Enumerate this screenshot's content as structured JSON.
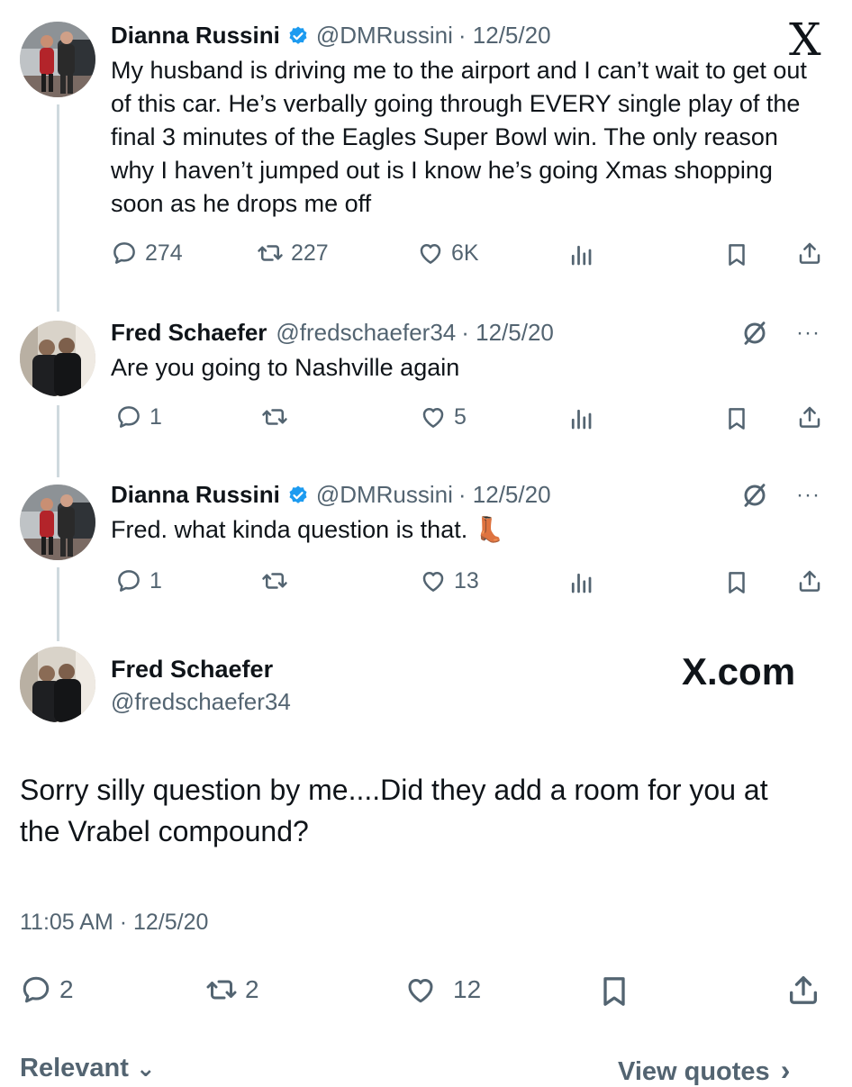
{
  "brand": {
    "x_logo": "X",
    "x_com": "X.com"
  },
  "tweets": [
    {
      "name": "Dianna Russini",
      "handle": "@DMRussini",
      "date": "· 12/5/20",
      "text": "My husband is driving me to the airport and I can’t wait to get out of this car. He’s verbally going through EVERY single play of the final 3 minutes of the Eagles Super Bowl win. The only reason why I haven’t jumped out is I know he’s going Xmas shopping soon as he drops me off",
      "replies": "274",
      "reposts": "227",
      "likes": "6K"
    },
    {
      "name": "Fred Schaefer",
      "handle": "@fredschaefer34",
      "date": "· 12/5/20",
      "text": "Are you going to Nashville again",
      "replies": "1",
      "reposts": "",
      "likes": "5",
      "more": "···"
    },
    {
      "name": "Dianna Russini",
      "handle": "@DMRussini",
      "date": "· 12/5/20",
      "text": "Fred. what kinda question is that. 👢",
      "replies": "1",
      "reposts": "",
      "likes": "13",
      "more": "···"
    }
  ],
  "main_tweet": {
    "name": "Fred Schaefer",
    "handle": "@fredschaefer34",
    "text": "Sorry silly question by me....Did they add a room for you at the Vrabel compound?",
    "timestamp": "11:05 AM · 12/5/20",
    "replies": "2",
    "reposts": "2",
    "likes": "12"
  },
  "footer": {
    "relevant": "Relevant",
    "relevant_chevron": "⌄",
    "view_quotes": "View quotes",
    "view_quotes_chevron": "›"
  },
  "colors": {
    "text": "#0f1419",
    "muted": "#536471",
    "verified": "#1d9bf0",
    "thread_line": "#cfd9de"
  },
  "icons": [
    "reply-icon",
    "repost-icon",
    "like-icon",
    "views-icon",
    "bookmark-icon",
    "share-icon",
    "verified-badge-icon",
    "muted-slash-icon",
    "more-icon",
    "x-logo"
  ]
}
